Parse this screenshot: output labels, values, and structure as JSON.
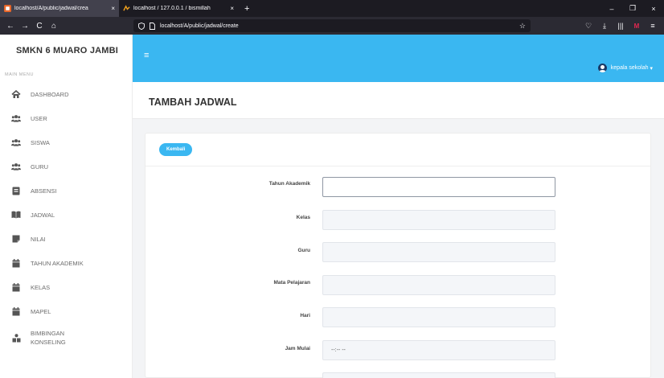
{
  "browser": {
    "tabs": [
      {
        "title": "localhost/A/public/jadwal/crea",
        "close": "×"
      },
      {
        "title": "localhost / 127.0.0.1 / bismillah",
        "close": "×"
      }
    ],
    "new_tab": "+",
    "url": "localhost/A/public/jadwal/create",
    "nav": {
      "back": "←",
      "forward": "→",
      "reload": "C",
      "home": "⌂"
    },
    "star": "☆",
    "tools": {
      "pocket": "♡",
      "download": "⤓",
      "library": "|||",
      "ext": "M",
      "menu": "≡"
    },
    "window": {
      "minimize": "–",
      "maximize": "❐",
      "close": "×"
    }
  },
  "sidebar": {
    "brand": "SMKN 6 MUARO JAMBI",
    "section": "MAIN MENU",
    "items": [
      {
        "label": "DASHBOARD",
        "icon": "home-icon"
      },
      {
        "label": "USER",
        "icon": "users-icon"
      },
      {
        "label": "SISWA",
        "icon": "users-icon"
      },
      {
        "label": "GURU",
        "icon": "users-icon"
      },
      {
        "label": "ABSENSI",
        "icon": "clipboard-icon"
      },
      {
        "label": "JADWAL",
        "icon": "book-icon"
      },
      {
        "label": "NILAI",
        "icon": "note-icon"
      },
      {
        "label": "TAHUN AKADEMIK",
        "icon": "calendar-icon"
      },
      {
        "label": "KELAS",
        "icon": "calendar-icon"
      },
      {
        "label": "MAPEL",
        "icon": "calendar-icon"
      },
      {
        "label": "BIMBINGAN",
        "label2": "KONSELING",
        "icon": "counseling-icon"
      }
    ]
  },
  "topbar": {
    "hamburger": "≡",
    "user": "kepala sekolah",
    "caret": "▾"
  },
  "page": {
    "title": "TAMBAH JADWAL",
    "back_button": "Kembali"
  },
  "form": {
    "fields": [
      {
        "label": "Tahun Akademik",
        "value": ""
      },
      {
        "label": "Kelas",
        "value": ""
      },
      {
        "label": "Guru",
        "value": ""
      },
      {
        "label": "Mata Pelajaran",
        "value": ""
      },
      {
        "label": "Hari",
        "value": ""
      },
      {
        "label": "Jam Mulai",
        "value": "--:-- --"
      }
    ]
  },
  "colors": {
    "accent": "#3ab7f1",
    "tabbar": "#1c1b22",
    "toolbar": "#2b2a33"
  }
}
